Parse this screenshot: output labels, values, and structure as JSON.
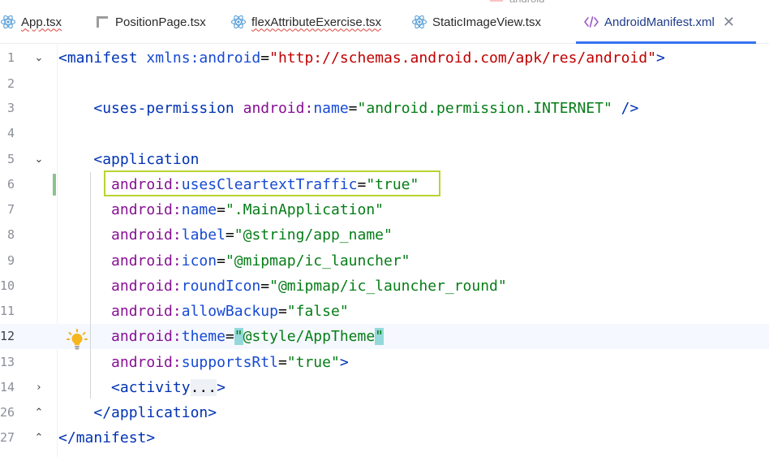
{
  "window": {
    "overflow_tab_label": "android"
  },
  "tabs": [
    {
      "label": "App.tsx",
      "icon": "react-icon",
      "spellcheck_squiggle": true,
      "active": false
    },
    {
      "label": "PositionPage.tsx",
      "icon": "file-icon",
      "spellcheck_squiggle": false,
      "active": false
    },
    {
      "label": "flexAttributeExercise.tsx",
      "icon": "react-icon",
      "spellcheck_squiggle": true,
      "active": false
    },
    {
      "label": "StaticImageView.tsx",
      "icon": "react-icon",
      "spellcheck_squiggle": false,
      "active": false
    },
    {
      "label": "AndroidManifest.xml",
      "icon": "xml-icon",
      "spellcheck_squiggle": false,
      "active": true,
      "close_label": "✕"
    }
  ],
  "editor": {
    "caret_line": "12",
    "highlighted_line": "6",
    "lines": [
      {
        "number": "1",
        "fold": "chevron-down"
      },
      {
        "number": "2"
      },
      {
        "number": "3"
      },
      {
        "number": "4"
      },
      {
        "number": "5",
        "fold": "chevron-down"
      },
      {
        "number": "6",
        "modified": true
      },
      {
        "number": "7"
      },
      {
        "number": "8"
      },
      {
        "number": "9"
      },
      {
        "number": "10"
      },
      {
        "number": "11"
      },
      {
        "number": "12",
        "intention_icon": "lightbulb-icon"
      },
      {
        "number": "13"
      },
      {
        "number": "14",
        "fold": "chevron-right"
      },
      {
        "number": "26",
        "fold": "chevron-up"
      },
      {
        "number": "27",
        "fold": "chevron-up"
      }
    ],
    "code": {
      "l1_open": "<",
      "l1_tag": "manifest",
      "l1_attr": "xmlns:android",
      "l1_eq": "=",
      "l1_value": "\"http://schemas.android.com/apk/res/android\"",
      "l1_close": ">",
      "l3_open": "<",
      "l3_tag": "uses-permission",
      "l3_ns": "android:",
      "l3_attr": "name",
      "l3_eq": "=",
      "l3_value": "\"android.permission.INTERNET\"",
      "l3_close": " />",
      "l5_open": "<",
      "l5_tag": "application",
      "l6_ns": "android:",
      "l6_attr": "usesCleartextTraffic",
      "l6_eq": "=",
      "l6_value": "\"true\"",
      "l7_ns": "android:",
      "l7_attr": "name",
      "l7_eq": "=",
      "l7_value": "\".MainApplication\"",
      "l8_ns": "android:",
      "l8_attr": "label",
      "l8_eq": "=",
      "l8_value": "\"@string/app_name\"",
      "l9_ns": "android:",
      "l9_attr": "icon",
      "l9_eq": "=",
      "l9_value": "\"@mipmap/ic_launcher\"",
      "l10_ns": "android:",
      "l10_attr": "roundIcon",
      "l10_eq": "=",
      "l10_value": "\"@mipmap/ic_launcher_round\"",
      "l11_ns": "android:",
      "l11_attr": "allowBackup",
      "l11_eq": "=",
      "l11_value": "\"false\"",
      "l12_ns": "android:",
      "l12_attr": "theme",
      "l12_eq": "=",
      "l12_quote_open": "\"",
      "l12_value": "@style/AppTheme",
      "l12_quote_close": "\"",
      "l13_ns": "android:",
      "l13_attr": "supportsRtl",
      "l13_eq": "=",
      "l13_value": "\"true\"",
      "l13_close": ">",
      "l14_open": "<",
      "l14_tag": "activity",
      "l14_fold": "...",
      "l14_close": ">",
      "l26_open": "</",
      "l26_tag": "application",
      "l26_close": ">",
      "l27_open": "</",
      "l27_tag": "manifest",
      "l27_close": ">"
    }
  },
  "colors": {
    "tag": "#0033b3",
    "attribute": "#174ad4",
    "namespace": "#871094",
    "string": "#067d17",
    "url": "#c00000",
    "highlight_box": "#b8d431",
    "active_tab_underline": "#3574f0",
    "modified_marker": "#8ac38c",
    "bracket_match": "#93d9d9"
  }
}
